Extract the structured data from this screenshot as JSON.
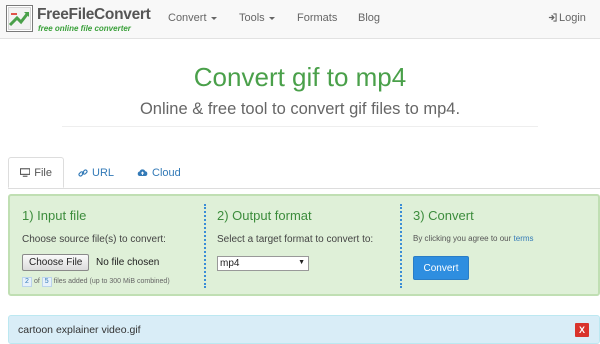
{
  "brand": {
    "name": "FreeFileConvert",
    "tagline": "free online file converter",
    "accent": "#4aa04a"
  },
  "nav": {
    "items": [
      {
        "label": "Convert",
        "has_caret": true
      },
      {
        "label": "Tools",
        "has_caret": true
      },
      {
        "label": "Formats",
        "has_caret": false
      },
      {
        "label": "Blog",
        "has_caret": false
      }
    ],
    "login_label": "Login",
    "login_icon": "sign-in-icon"
  },
  "hero": {
    "title": "Convert gif to mp4",
    "subtitle": "Online & free tool to convert gif files to mp4."
  },
  "tabs": [
    {
      "label": "File",
      "icon": "monitor-icon",
      "active": true
    },
    {
      "label": "URL",
      "icon": "link-icon",
      "active": false
    },
    {
      "label": "Cloud",
      "icon": "cloud-icon",
      "active": false
    }
  ],
  "panel": {
    "input": {
      "title": "1) Input file",
      "instruction": "Choose source file(s) to convert:",
      "choose_button": "Choose File",
      "file_status": "No file chosen",
      "files_added": "2",
      "files_max": "5",
      "of_text": "of",
      "limit_text": "files added (up to 300 MiB combined)"
    },
    "output": {
      "title": "2) Output format",
      "instruction": "Select a target format to convert to:",
      "selected_format": "mp4"
    },
    "convert": {
      "title": "3) Convert",
      "agree_text": "By clicking you agree to our",
      "terms_link": "terms",
      "button_label": "Convert",
      "button_color": "#2e8ee0"
    }
  },
  "file_list": [
    {
      "name": "cartoon explainer video.gif",
      "remove_label": "X"
    }
  ]
}
